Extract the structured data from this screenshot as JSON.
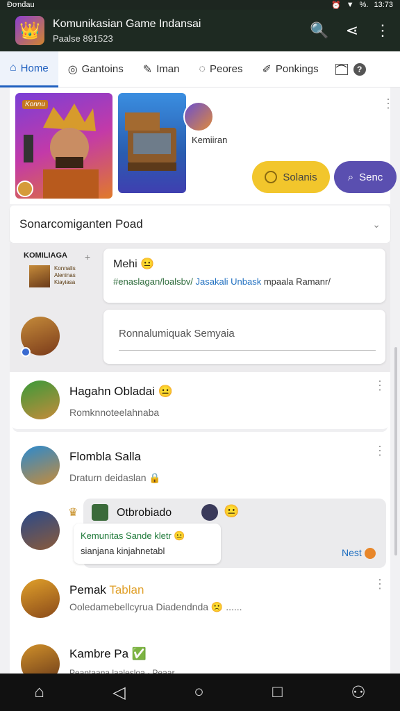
{
  "status_bar": {
    "left": "Đơnđau",
    "time": "13:73",
    "signal": "%."
  },
  "header": {
    "title": "Komunikasian Game Indansai",
    "subtitle": "Paalse 891523"
  },
  "tabs": [
    {
      "label": "Home",
      "icon": "home-icon",
      "active": true
    },
    {
      "label": "Gantoins",
      "icon": "gamepad-icon",
      "active": false
    },
    {
      "label": "Iman",
      "icon": "pin-icon",
      "active": false
    },
    {
      "label": "Peores",
      "icon": "chat-icon",
      "active": false
    },
    {
      "label": "Ponkings",
      "icon": "pencil-icon",
      "active": false
    }
  ],
  "hero": {
    "thumb_badge": "Konnu",
    "avatar_caption": "Kemiiran",
    "pill_yellow": "Solanis",
    "pill_purple": "Senc"
  },
  "feed": {
    "section_title": "Sonarcomiganten Poad",
    "composer_avatar_label": "KOMILIAGA",
    "composer_avatar_small": "Konnalis Aleninas Kiayiasa",
    "post1_title": "Mehi 😐",
    "post1_body_tag": "#enaslagan/loalsbv/",
    "post1_body_link": "Jasakali Unbask",
    "post1_body_rest": "mpaala Ramanr/",
    "reply_placeholder": "Ronnalumiquak Semyaia"
  },
  "list": [
    {
      "name": "Hagahn Obladai",
      "emoji": "😐",
      "sub": "Romknnoteelahnaba"
    },
    {
      "name": "Flombla Salla",
      "emoji": "",
      "sub": "Draturn deidaslan 🔒"
    },
    {
      "name": "Pemak",
      "highlight": "Tablan",
      "emoji": "",
      "sub": "Ooledamebellcyrua Diadendnda 🙁 ......"
    },
    {
      "name": "Kambre Pa",
      "emoji": "✅",
      "sub": "Peantaana laalesloa · Peaar"
    }
  ],
  "chat": {
    "group_title": "Otbrobiado",
    "bubble_line1": "Kemunitas Sande kletr 😐",
    "bubble_line2": "sianjana kinjahnetabl",
    "next_label": "Nest"
  },
  "colors": {
    "appbar": "#1e2a22",
    "accent_blue": "#1f5fbf",
    "pill_yellow": "#f2c62c",
    "pill_purple": "#5a4fb0"
  }
}
